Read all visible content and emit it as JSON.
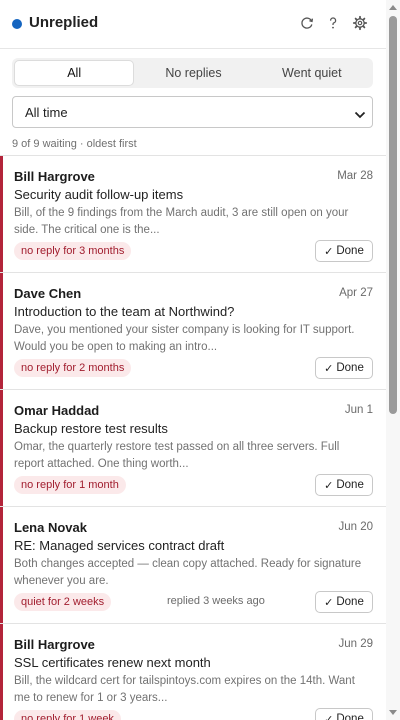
{
  "header": {
    "title": "Unreplied",
    "status_color": "#1565c0",
    "icons": [
      "refresh-icon",
      "help-icon",
      "settings-icon"
    ]
  },
  "tabs": [
    {
      "label": "All",
      "active": true
    },
    {
      "label": "No replies",
      "active": false
    },
    {
      "label": "Went quiet",
      "active": false
    }
  ],
  "filter": {
    "selected": "All time"
  },
  "summary": "9 of 9 waiting · oldest first",
  "colors": {
    "accent": "#b3243a",
    "badge_bg": "#fbe9ea",
    "badge_text": "#a11d2e"
  },
  "done_label": "Done",
  "items": [
    {
      "sender": "Bill Hargrove",
      "date": "Mar 28",
      "subject": "Security audit follow-up items",
      "preview": "Bill, of the 9 findings from the March audit, 3 are still open on your side. The critical one is the...",
      "badge": "no reply for 3 months",
      "replied": ""
    },
    {
      "sender": "Dave Chen",
      "date": "Apr 27",
      "subject": "Introduction to the team at Northwind?",
      "preview": "Dave, you mentioned your sister company is looking for IT support. Would you be open to making an intro...",
      "badge": "no reply for 2 months",
      "replied": ""
    },
    {
      "sender": "Omar Haddad",
      "date": "Jun 1",
      "subject": "Backup restore test results",
      "preview": "Omar, the quarterly restore test passed on all three servers. Full report attached. One thing worth...",
      "badge": "no reply for 1 month",
      "replied": ""
    },
    {
      "sender": "Lena Novak",
      "date": "Jun 20",
      "subject": "RE: Managed services contract draft",
      "preview": "Both changes accepted — clean copy attached. Ready for signature whenever you are.",
      "badge": "quiet for 2 weeks",
      "replied": "replied 3 weeks ago"
    },
    {
      "sender": "Bill Hargrove",
      "date": "Jun 29",
      "subject": "SSL certificates renew next month",
      "preview": "Bill, the wildcard cert for tailspintoys.com expires on the 14th. Want me to renew for 1 or 3 years...",
      "badge": "no reply for 1 week",
      "replied": ""
    }
  ]
}
